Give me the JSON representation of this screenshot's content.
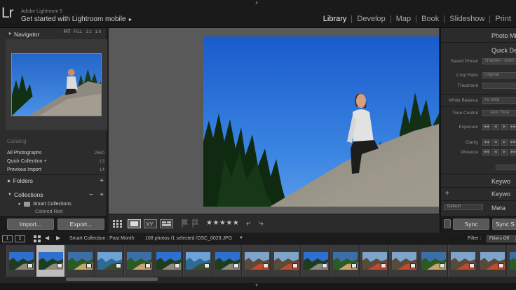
{
  "app": {
    "logo": "Lr",
    "name": "Adobe Lightroom 5",
    "promo": "Get started with Lightroom mobile",
    "promo_arrow": "►"
  },
  "modules": [
    {
      "label": "Library",
      "active": true
    },
    {
      "label": "Develop",
      "active": false
    },
    {
      "label": "Map",
      "active": false
    },
    {
      "label": "Book",
      "active": false
    },
    {
      "label": "Slideshow",
      "active": false
    },
    {
      "label": "Print",
      "active": false
    }
  ],
  "left": {
    "navigator_title": "Navigator",
    "zoom": {
      "fit": "FIT",
      "fill": "FILL",
      "one": "1:1",
      "ratio": "1:8"
    },
    "catalog_title": "Catalog",
    "catalog": [
      {
        "label": "All Photographs",
        "count": "2660"
      },
      {
        "label": "Quick Collection +",
        "count": "13"
      },
      {
        "label": "Previous Import",
        "count": "14"
      }
    ],
    "folders_title": "Folders",
    "collections_title": "Collections",
    "smart_collections": "Smart Collections",
    "colored_rest": "Colored Red",
    "import": "Import...",
    "export": "Export..."
  },
  "right": {
    "histogram_title": "Photo Mi",
    "quick_develop_title": "Quick Dev",
    "saved_preset_label": "Saved Preset",
    "saved_preset_value": "Sharpen - Scen",
    "crop_ratio_label": "Crop Ratio",
    "crop_ratio_value": "Original",
    "treatment_label": "Treatment",
    "treatment_value": "",
    "white_balance_label": "White Balance",
    "white_balance_value": "As Shot",
    "tone_control_label": "Tone Control",
    "tone_button": "Auto Tone",
    "exposure_label": "Exposure",
    "clarity_label": "Clarity",
    "vibrance_label": "Vibrance",
    "keywording_title": "Keywo",
    "keyword_list_title": "Keywo",
    "default_label": "Default",
    "metadata_title": "Meta",
    "sync": "Sync",
    "sync_settings": "Sync S"
  },
  "toolbar": {
    "stars": "★★★★★",
    "rotate_left": "⤶",
    "rotate_right": "⤷"
  },
  "filmbar": {
    "monitor1": "1",
    "monitor2": "2",
    "source": "Smart Collection : Past Month",
    "count": "108 photos /1 selected /DSC_0029.JPG",
    "filter_label": "Filter :",
    "filter_value": "Filters Off"
  },
  "filmstrip": {
    "selected_index": 1,
    "thumbs": [
      "sky",
      "sky",
      "trees",
      "lake",
      "trees",
      "sky",
      "lake",
      "sky",
      "people",
      "people",
      "sky",
      "trees",
      "people",
      "people",
      "trees",
      "people",
      "people",
      "trees"
    ]
  }
}
